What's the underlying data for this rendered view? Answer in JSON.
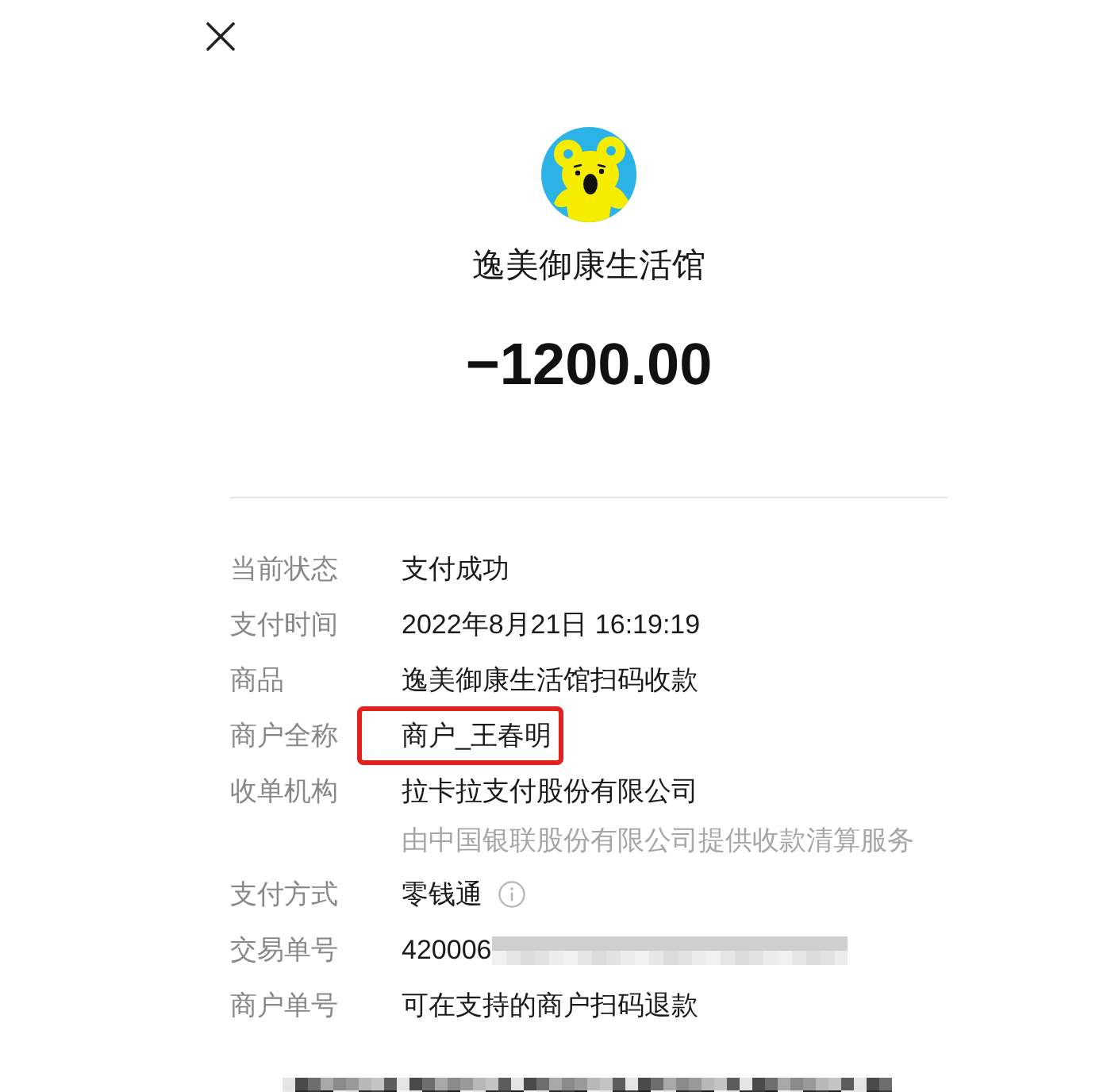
{
  "merchant": {
    "name": "逸美御康生活馆"
  },
  "amount": "−1200.00",
  "details": [
    {
      "label": "当前状态",
      "value": "支付成功",
      "highlighted": false,
      "info": false,
      "redacted": false
    },
    {
      "label": "支付时间",
      "value": "2022年8月21日 16:19:19",
      "highlighted": false,
      "info": false,
      "redacted": false
    },
    {
      "label": "商品",
      "value": "逸美御康生活馆扫码收款",
      "highlighted": false,
      "info": false,
      "redacted": false
    },
    {
      "label": "商户全称",
      "value": "商户_王春明",
      "highlighted": true,
      "info": false,
      "redacted": false
    },
    {
      "label": "收单机构",
      "value": "拉卡拉支付股份有限公司",
      "note": "由中国银联股份有限公司提供收款清算服务",
      "highlighted": false,
      "info": false,
      "redacted": false
    },
    {
      "label": "支付方式",
      "value": "零钱通",
      "highlighted": false,
      "info": true,
      "redacted": false
    },
    {
      "label": "交易单号",
      "value": "420006",
      "highlighted": false,
      "info": false,
      "redacted": true
    },
    {
      "label": "商户单号",
      "value": "可在支持的商户扫码退款",
      "highlighted": false,
      "info": false,
      "redacted": false
    }
  ],
  "footer": {
    "redacted": true
  }
}
